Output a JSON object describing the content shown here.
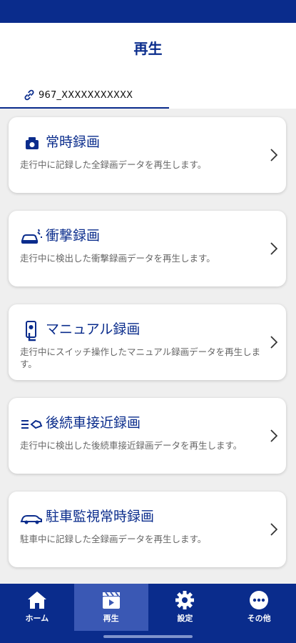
{
  "header": {
    "title": "再生",
    "device_id": "967_XXXXXXXXXXX"
  },
  "recordings": [
    {
      "title": "常時録画",
      "description": "走行中に記録した全録画データを再生します。",
      "icon": "camera-icon"
    },
    {
      "title": "衝撃録画",
      "description": "走行中に検出した衝撃録画データを再生します。",
      "icon": "car-crash-icon"
    },
    {
      "title": "マニュアル録画",
      "description": "走行中にスイッチ操作したマニュアル録画データを再生します。",
      "icon": "hand-switch-icon"
    },
    {
      "title": "後続車接近録画",
      "description": "走行中に検出した後続車接近録画データを再生します。",
      "icon": "approaching-car-icon"
    },
    {
      "title": "駐車監視常時録画",
      "description": "駐車中に記録した全録画データを再生します。",
      "icon": "parked-car-icon"
    }
  ],
  "bottom_nav": [
    {
      "label": "ホーム",
      "icon": "home-icon",
      "active": false
    },
    {
      "label": "再生",
      "icon": "clapperboard-icon",
      "active": true
    },
    {
      "label": "設定",
      "icon": "gear-icon",
      "active": false
    },
    {
      "label": "その他",
      "icon": "more-icon",
      "active": false
    }
  ],
  "colors": {
    "brand": "#0a2c8c",
    "active_tab": "#3a58b4",
    "background": "#efefef"
  }
}
